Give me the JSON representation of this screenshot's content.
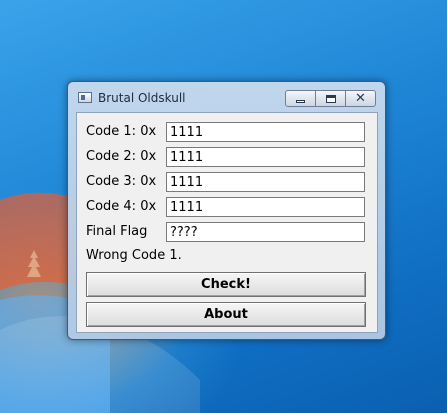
{
  "window": {
    "title": "Brutal Oldskull"
  },
  "form": {
    "rows": [
      {
        "label": "Code 1: 0x",
        "value": "1111"
      },
      {
        "label": "Code 2: 0x",
        "value": "1111"
      },
      {
        "label": "Code 3: 0x",
        "value": "1111"
      },
      {
        "label": "Code 4: 0x",
        "value": "1111"
      },
      {
        "label": "Final Flag",
        "value": "????"
      }
    ],
    "status": "Wrong Code 1."
  },
  "buttons": {
    "check": "Check!",
    "about": "About"
  },
  "caption_buttons": {
    "minimize": "minimize-icon",
    "maximize": "maximize-icon",
    "close": "close-icon"
  },
  "colors": {
    "desktop": "#1a7fd6",
    "window_frame": "#b8cce4",
    "client": "#f0f0f0"
  }
}
